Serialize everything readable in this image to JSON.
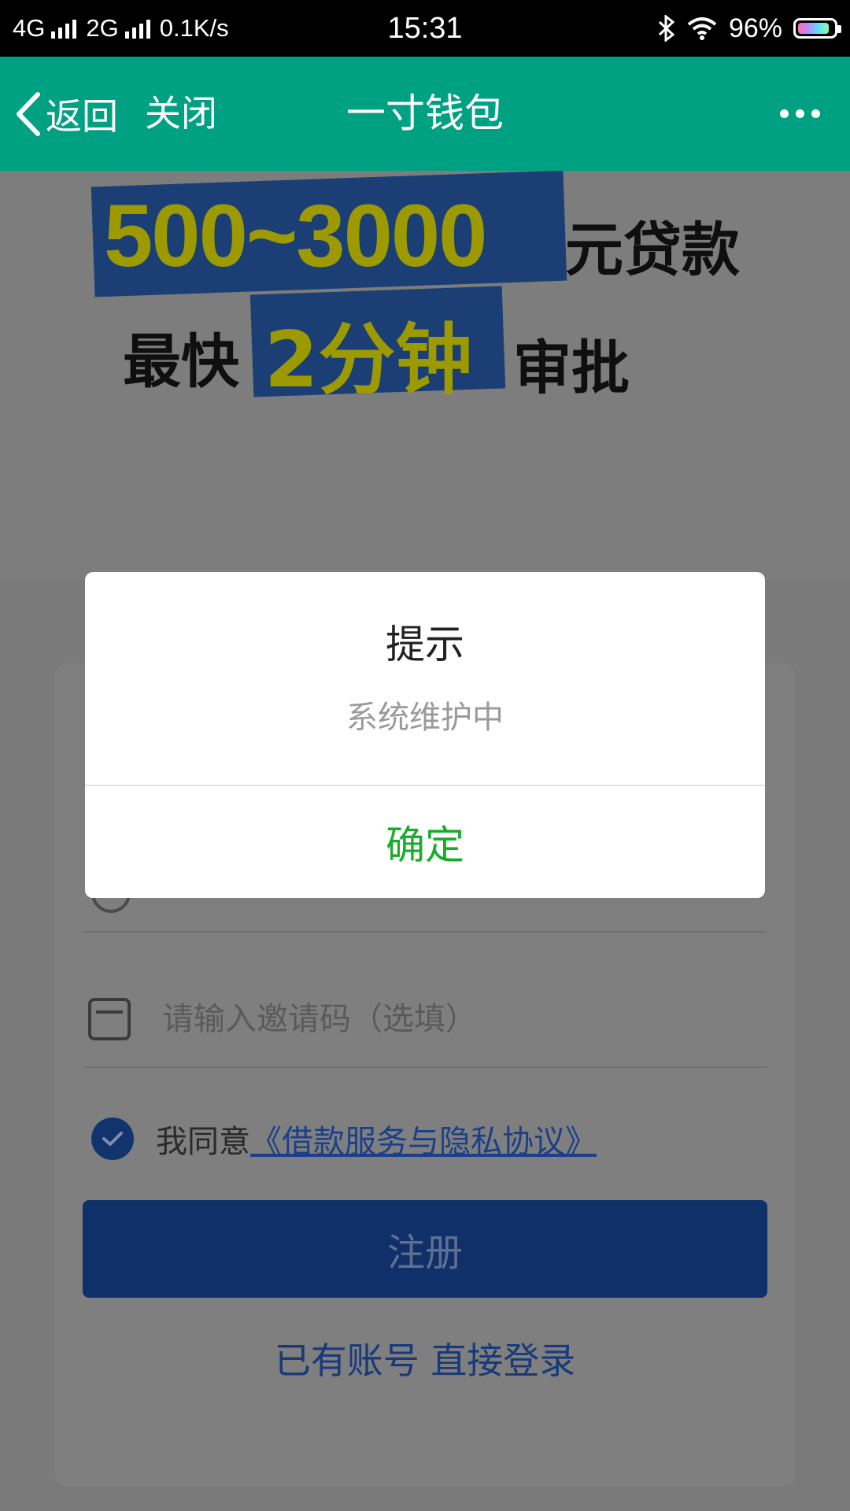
{
  "status_bar": {
    "network_1": "4G",
    "network_2": "2G",
    "speed": "0.1K/s",
    "time": "15:31",
    "battery": "96%"
  },
  "title_bar": {
    "back_label": "返回",
    "close_label": "关闭",
    "title": "一寸钱包",
    "accent_color": "#00C4A0"
  },
  "banner": {
    "amount": "500~3000",
    "unit": "元贷款",
    "fastest": "最快",
    "duration": "2分钟",
    "approve": "审批"
  },
  "form": {
    "invite_placeholder": "请输入邀请码（选填）",
    "agree_prefix": "我同意",
    "agree_link": "《借款服务与隐私协议》",
    "register_label": "注册",
    "login_link": "已有账号 直接登录"
  },
  "dialog": {
    "title": "提示",
    "message": "系统维护中",
    "ok_label": "确定",
    "ok_color": "#1AAB2B"
  },
  "icons": {
    "back": "chevron-left-icon",
    "more": "more-dots-icon",
    "invite": "ticket-icon",
    "check": "checkmark-icon"
  }
}
